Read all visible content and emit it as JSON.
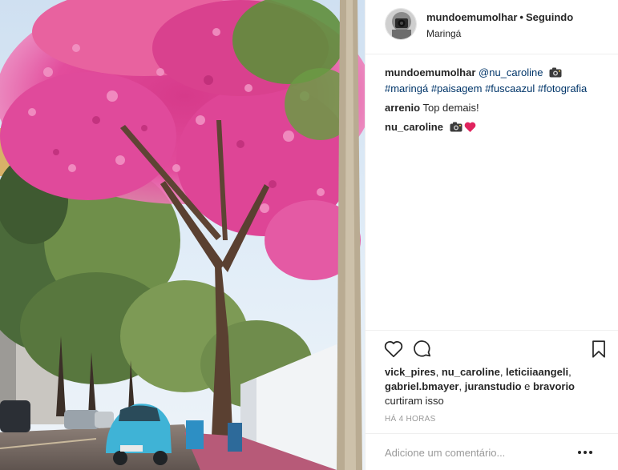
{
  "post": {
    "photo_alt": "",
    "header": {
      "username": "mundoemumolhar",
      "separator": "•",
      "follow_label": "Seguindo",
      "location": "Maringá",
      "avatar_icon": "camera-avatar"
    },
    "caption": {
      "username": "mundoemumolhar",
      "mention": "@nu_caroline",
      "emoji_icon": "camera-icon",
      "hashtags": [
        "#maringá",
        "#paisagem",
        "#fuscaazul",
        "#fotografia"
      ]
    },
    "comments": [
      {
        "username": "arrenio",
        "text": "Top demais!"
      },
      {
        "username": "nu_caroline",
        "emojis": [
          "camera-icon",
          "heart-icon"
        ]
      }
    ],
    "actions": {
      "like_icon": "heart-outline-icon",
      "comment_icon": "comment-bubble-icon",
      "save_icon": "bookmark-icon"
    },
    "likes": {
      "users": [
        "vick_pires",
        "nu_caroline",
        "leticiiaangeli",
        "gabriel.bmayer",
        "juranstudio",
        "bravorio"
      ],
      "separator_comma": ", ",
      "conjunction": " e ",
      "suffix": "curtiram isso"
    },
    "timestamp": "HÁ 4 HORAS",
    "add_comment": {
      "placeholder": "Adicione um comentário...",
      "more_icon": "more-options-icon"
    },
    "colors": {
      "text": "#262626",
      "link": "#003569",
      "muted": "#999999",
      "divider": "#efefef",
      "heart_red": "#e0245e",
      "blossom": "#e2479b",
      "beetle_blue": "#3fb3d6"
    }
  }
}
